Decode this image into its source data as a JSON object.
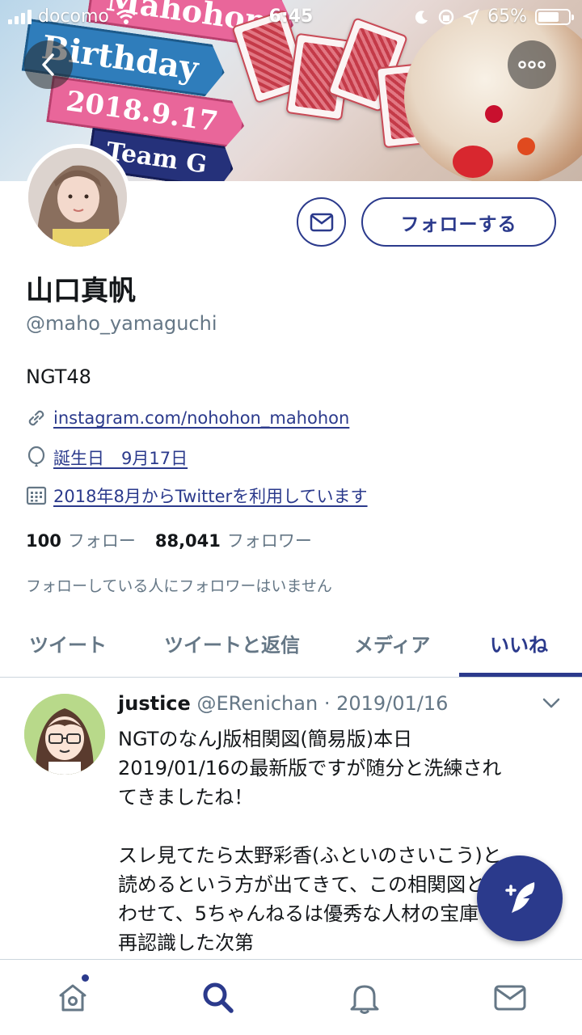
{
  "status_bar": {
    "carrier": "docomo",
    "time": "6:45",
    "battery": "65%"
  },
  "banner": {
    "signs": [
      "Mahohon",
      "Birthday",
      "2018.9.17",
      "Team G"
    ]
  },
  "profile": {
    "name": "山口真帆",
    "handle": "@maho_yamaguchi",
    "bio": "NGT48",
    "link": "instagram.com/nohohon_mahohon",
    "birthday": "誕生日　9月17日",
    "joined": "2018年8月からTwitterを利用しています",
    "following_count": "100",
    "following_label": "フォロー",
    "followers_count": "88,041",
    "followers_label": "フォロワー",
    "followers_note": "フォローしている人にフォロワーはいません",
    "follow_button": "フォローする"
  },
  "tabs": [
    "ツイート",
    "ツイートと返信",
    "メディア",
    "いいね"
  ],
  "active_tab": "いいね",
  "tweet": {
    "display_name": "justice",
    "username": "@ERenichan",
    "date": "· 2019/01/16",
    "lines": [
      "NGTのなんJ版相関図(簡易版)本日",
      "2019/01/16の最新版ですが随分と洗練され",
      "てきましたね！",
      "",
      "スレ見てたら太野彩香(ふといのさいこう)と",
      "読めるという方が出てきて、この相関図と合",
      "わせて、5ちゃんねるは優秀な人材の宝庫と",
      "再認識した次第"
    ]
  },
  "colors": {
    "accent": "#2b3a8c",
    "secondary_text": "#657786",
    "divider": "#ccd6dd"
  },
  "icons": {
    "back": "chevron-left-icon",
    "more": "ellipsis-icon",
    "message": "envelope-icon",
    "link": "link-icon",
    "birthday": "balloon-icon",
    "calendar": "calendar-icon",
    "compose": "feather-plus-icon",
    "nav": [
      "home-icon",
      "search-icon",
      "bell-icon",
      "mail-icon"
    ]
  }
}
